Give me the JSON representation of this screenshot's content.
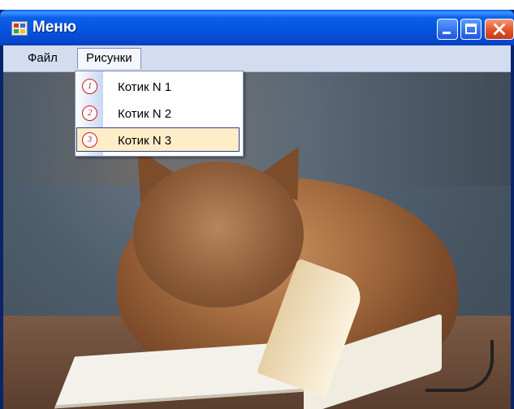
{
  "window": {
    "title": "Меню",
    "icon": "app-icon"
  },
  "titlebar_buttons": {
    "minimize": "minimize-icon",
    "maximize": "maximize-icon",
    "close": "close-icon"
  },
  "menubar": {
    "items": [
      {
        "label": "Файл"
      },
      {
        "label": "Рисунки"
      }
    ]
  },
  "dropdown": {
    "items": [
      {
        "label": "Котик N 1",
        "icon_text": "1",
        "icon": "circle-number-1-icon"
      },
      {
        "label": "Котик N 2",
        "icon_text": "2",
        "icon": "circle-number-2-icon"
      },
      {
        "label": "Котик N 3",
        "icon_text": "3",
        "icon": "circle-number-3-icon",
        "selected": true
      }
    ]
  },
  "content": {
    "image": "cat-reading-book-photo"
  },
  "colors": {
    "titlebar": "#0553dd",
    "menubar": "#d4dcf0",
    "highlight": "#ffedc8",
    "highlight_border": "#31418f",
    "icon_red": "#c71a1a"
  }
}
